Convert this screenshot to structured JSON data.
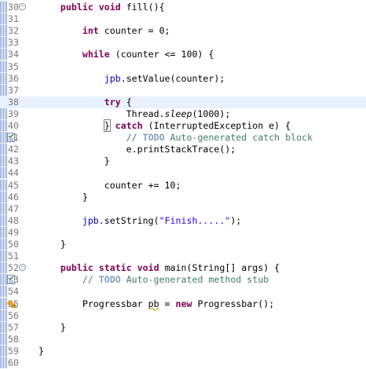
{
  "editor": {
    "lines": [
      {
        "num": "30",
        "fold": "⊖",
        "tokens": [
          {
            "t": "    "
          },
          {
            "t": "public",
            "c": "kw"
          },
          {
            "t": " "
          },
          {
            "t": "void",
            "c": "kw"
          },
          {
            "t": " fill(){"
          }
        ]
      },
      {
        "num": "31",
        "tokens": [
          {
            "t": ""
          }
        ]
      },
      {
        "num": "32",
        "tokens": [
          {
            "t": "        "
          },
          {
            "t": "int",
            "c": "kw"
          },
          {
            "t": " counter = 0;"
          }
        ]
      },
      {
        "num": "33",
        "tokens": [
          {
            "t": ""
          }
        ]
      },
      {
        "num": "34",
        "tokens": [
          {
            "t": "        "
          },
          {
            "t": "while",
            "c": "kw"
          },
          {
            "t": " (counter <= 100) {"
          }
        ]
      },
      {
        "num": "35",
        "tokens": [
          {
            "t": ""
          }
        ]
      },
      {
        "num": "36",
        "tokens": [
          {
            "t": "            "
          },
          {
            "t": "jpb",
            "c": "fld"
          },
          {
            "t": ".setValue(counter);"
          }
        ]
      },
      {
        "num": "37",
        "tokens": [
          {
            "t": ""
          }
        ]
      },
      {
        "num": "38",
        "current": true,
        "tokens": [
          {
            "t": "            "
          },
          {
            "t": "try",
            "c": "kw"
          },
          {
            "t": " {"
          }
        ]
      },
      {
        "num": "39",
        "tokens": [
          {
            "t": "                Thread."
          },
          {
            "t": "sleep",
            "c": "ital"
          },
          {
            "t": "(1000);"
          }
        ]
      },
      {
        "num": "40",
        "tokens": [
          {
            "t": "            "
          },
          {
            "t": "}",
            "c": "caret-box"
          },
          {
            "t": " "
          },
          {
            "t": "catch",
            "c": "kw"
          },
          {
            "t": " (InterruptedException e) {"
          }
        ]
      },
      {
        "num": "41",
        "marker": "task",
        "tokens": [
          {
            "t": "                "
          },
          {
            "t": "// ",
            "c": "cmt"
          },
          {
            "t": "TODO",
            "c": "todo"
          },
          {
            "t": " Auto-generated catch block",
            "c": "cmt"
          }
        ]
      },
      {
        "num": "42",
        "tokens": [
          {
            "t": "                e.printStackTrace();"
          }
        ]
      },
      {
        "num": "43",
        "tokens": [
          {
            "t": "            }"
          }
        ]
      },
      {
        "num": "44",
        "tokens": [
          {
            "t": ""
          }
        ]
      },
      {
        "num": "45",
        "tokens": [
          {
            "t": "            counter += 10;"
          }
        ]
      },
      {
        "num": "46",
        "tokens": [
          {
            "t": "        }"
          }
        ]
      },
      {
        "num": "47",
        "tokens": [
          {
            "t": ""
          }
        ]
      },
      {
        "num": "48",
        "tokens": [
          {
            "t": "        "
          },
          {
            "t": "jpb",
            "c": "fld"
          },
          {
            "t": ".setString("
          },
          {
            "t": "\"Finish.....\"",
            "c": "str"
          },
          {
            "t": ");"
          }
        ]
      },
      {
        "num": "49",
        "tokens": [
          {
            "t": ""
          }
        ]
      },
      {
        "num": "50",
        "tokens": [
          {
            "t": "    }"
          }
        ]
      },
      {
        "num": "51",
        "tokens": [
          {
            "t": ""
          }
        ]
      },
      {
        "num": "52",
        "fold": "⊖",
        "tokens": [
          {
            "t": "    "
          },
          {
            "t": "public",
            "c": "kw"
          },
          {
            "t": " "
          },
          {
            "t": "static",
            "c": "kw"
          },
          {
            "t": " "
          },
          {
            "t": "void",
            "c": "kw"
          },
          {
            "t": " main(String[] args) {"
          }
        ]
      },
      {
        "num": "53",
        "marker": "task",
        "tokens": [
          {
            "t": "        "
          },
          {
            "t": "// ",
            "c": "cmt"
          },
          {
            "t": "TODO",
            "c": "todo"
          },
          {
            "t": " Auto-generated method stub",
            "c": "cmt"
          }
        ]
      },
      {
        "num": "54",
        "tokens": [
          {
            "t": ""
          }
        ]
      },
      {
        "num": "55",
        "marker": "warning",
        "tokens": [
          {
            "t": "        Progressbar "
          },
          {
            "t": "pb",
            "c": "warnvar"
          },
          {
            "t": " = "
          },
          {
            "t": "new",
            "c": "kw"
          },
          {
            "t": " Progressbar();"
          }
        ]
      },
      {
        "num": "56",
        "tokens": [
          {
            "t": ""
          }
        ]
      },
      {
        "num": "57",
        "tokens": [
          {
            "t": "    }"
          }
        ]
      },
      {
        "num": "58",
        "tokens": [
          {
            "t": ""
          }
        ]
      },
      {
        "num": "59",
        "tokens": [
          {
            "t": "}"
          }
        ]
      },
      {
        "num": "60",
        "tokens": [
          {
            "t": ""
          }
        ]
      }
    ],
    "colors": {
      "keyword": "#7f0055",
      "comment": "#3f7f5f",
      "todo": "#7f9fbf",
      "field": "#0000c0",
      "string": "#2a00ff",
      "current_line": "#e8f2fe"
    },
    "icons": {
      "fold": "collapse-icon",
      "task": "task-marker-icon",
      "warning": "warning-marker-icon"
    }
  }
}
